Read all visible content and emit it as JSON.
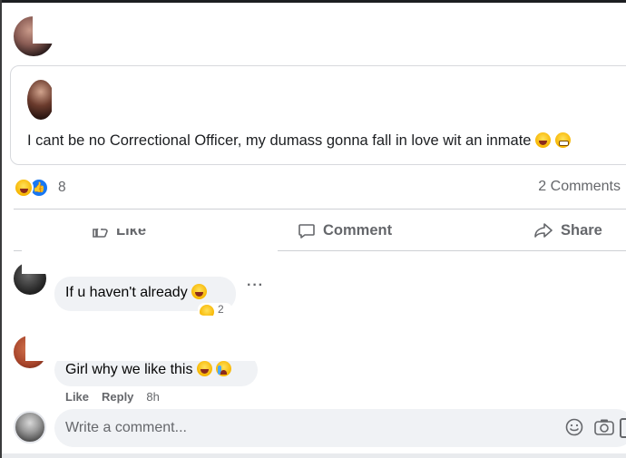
{
  "shared_post": {
    "text": "I cant be no Correctional Officer, my dumass gonna fall in love wit an inmate",
    "emojis": [
      "rofl-emoji",
      "grimace-emoji"
    ]
  },
  "reactions": {
    "types": [
      "haha",
      "like"
    ],
    "count": "8"
  },
  "comments_count_label": "2 Comments",
  "actions": {
    "like": "Like",
    "comment": "Comment",
    "share": "Share"
  },
  "comments": [
    {
      "text": "If u haven't already",
      "emoji": "rofl-emoji",
      "reaction_count": "2"
    },
    {
      "text": "Girl why we like this",
      "emojis": [
        "rofl-emoji",
        "crying-emoji"
      ],
      "like_label": "Like",
      "reply_label": "Reply",
      "time": "8h"
    }
  ],
  "composer": {
    "placeholder": "Write a comment..."
  },
  "colors": {
    "like_blue": "#1877f2",
    "muted_text": "#65676b",
    "bubble_bg": "#f0f2f5",
    "divider": "#ced0d4"
  }
}
